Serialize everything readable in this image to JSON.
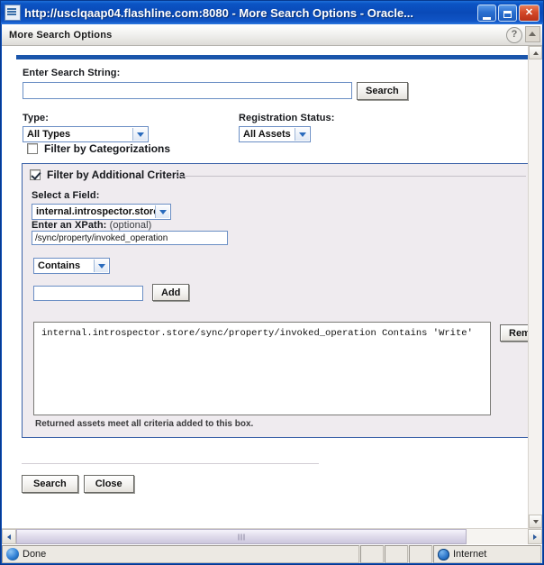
{
  "window": {
    "title": "http://usclqaap04.flashline.com:8080 - More Search Options - Oracle...",
    "app_icon": "browser-page-icon",
    "minimize_label": "",
    "maximize_label": "",
    "close_label": "✕"
  },
  "page_header": {
    "title": "More Search Options",
    "help_glyph": "?"
  },
  "search": {
    "label": "Enter Search String:",
    "value": "",
    "placeholder": "",
    "button_label": "Search"
  },
  "filters": {
    "type_label": "Type:",
    "type_value": "All Types",
    "registration_label": "Registration Status:",
    "registration_value": "All Assets",
    "categorizations_label": "Filter by Categorizations",
    "categorizations_checked": false
  },
  "additional_criteria": {
    "title": "Filter by Additional Criteria",
    "checked": true,
    "field_label": "Select a Field:",
    "field_value": "internal.introspector.store",
    "xpath_label": "Enter an XPath:",
    "xpath_label_optional": "(optional)",
    "xpath_value": "/sync/property/invoked_operation",
    "operator_value": "Contains",
    "criteria_value": "",
    "add_button_label": "Add",
    "remove_button_label": "Remove",
    "criteria_list": [
      "internal.introspector.store/sync/property/invoked_operation Contains 'Write'"
    ],
    "hint": "Returned assets meet all criteria added to this box."
  },
  "actions": {
    "search_label": "Search",
    "close_label": "Close"
  },
  "statusbar": {
    "message": "Done",
    "zone": "Internet",
    "status_icon": "page-done-icon",
    "zone_icon": "globe-icon"
  },
  "scrollbars": {
    "v_up": "scroll-up-arrow",
    "v_down": "scroll-down-arrow",
    "h_left": "scroll-left-arrow",
    "h_right": "scroll-right-arrow"
  },
  "colors": {
    "title_blue": "#0a4bb5",
    "accent_rule": "#1a55ab",
    "panel_border": "#3b62a8",
    "panel_bg": "#efebef",
    "close_red": "#d4492a"
  }
}
